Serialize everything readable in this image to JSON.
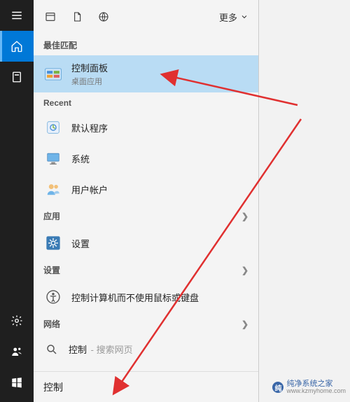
{
  "topbar": {
    "more_label": "更多"
  },
  "sections": {
    "best_match": "最佳匹配",
    "recent": "Recent"
  },
  "best_match": {
    "title": "控制面板",
    "subtitle": "桌面应用"
  },
  "recent_items": [
    {
      "label": "默认程序"
    },
    {
      "label": "系统"
    },
    {
      "label": "用户帐户"
    }
  ],
  "categories": {
    "apps": "应用",
    "settings_cat": "设置",
    "network": "网络"
  },
  "apps_items": [
    {
      "label": "设置"
    }
  ],
  "settings_items": [
    {
      "label": "控制计算机而不使用鼠标或键盘"
    }
  ],
  "network": {
    "prefix": "控制",
    "suffix": " - 搜索网页"
  },
  "search": {
    "value": "控制"
  },
  "watermark": {
    "title": "纯净系统之家",
    "url": "www.kzmyhome.com"
  }
}
